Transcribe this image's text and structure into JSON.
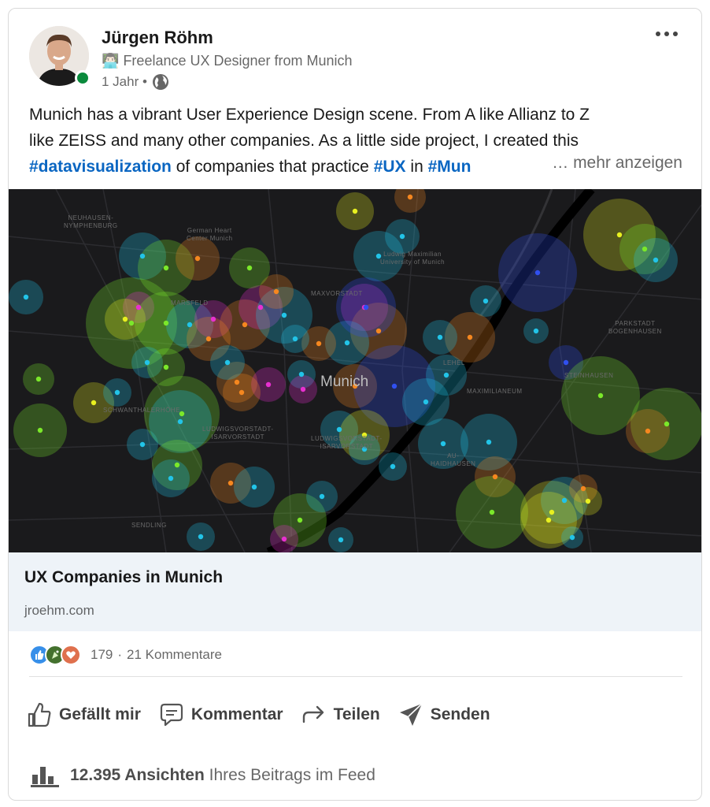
{
  "author": {
    "name": "Jürgen Röhm",
    "headline_emoji": "👨🏻‍💻",
    "headline": "Freelance UX Designer from Munich",
    "time": "1 Jahr •"
  },
  "post": {
    "line1": "Munich has a vibrant User Experience Design scene. From A like Allianz to Z",
    "line2": "like ZEISS and many other companies. As a little side project, I created this",
    "hashtag_dataviz": "#datavisualization",
    "text_mid": " of companies that practice ",
    "hashtag_ux": "#UX",
    "text_in": " in ",
    "hashtag_mun": "#Mun",
    "see_more": "… mehr anzeigen"
  },
  "map": {
    "city_label": "Munich",
    "labels": {
      "neuhausen": "NEUHAUSEN-\nNYMPHENBURG",
      "heart": "German Heart\nCenter Munich",
      "maxvorstadt": "MAXVORSTADT",
      "marsfeld": "MARSFELD",
      "parkstadt": "PARKSTADT\nBOGENHAUSEN",
      "lehel": "LEHEL",
      "steinhausen": "STEINHAUSEN",
      "maximilianeum": "MAXIMILIANEUM",
      "schwanthaler": "SCHWANTHALERHÖHE",
      "ludwigs": "LUDWIGSVORSTADT-\nISARVORSTADT",
      "isarvorstadt": "LUDWIGSVORSTADT-\nISARVORSTADT",
      "au": "AU-\nHAIDHAUSEN",
      "sendling": "SENDLING",
      "lmu": "Ludwig Maximilian\nUniversity of Munich"
    },
    "colors": {
      "background": "#1a1a1c",
      "cyan": "#22c4e8",
      "green": "#7be82a",
      "orange": "#f5871f",
      "magenta": "#e830d0",
      "yellow": "#e8f020",
      "blue": "#3050f0"
    }
  },
  "link": {
    "title": "UX Companies in Munich",
    "domain": "jroehm.com"
  },
  "social": {
    "count": "179",
    "comments": "21 Kommentare"
  },
  "actions": {
    "like": "Gefällt mir",
    "comment": "Kommentar",
    "share": "Teilen",
    "send": "Senden"
  },
  "views": {
    "count": "12.395 Ansichten",
    "suffix": "Ihres Beitrags im Feed"
  },
  "icons": {
    "globe": "globe-icon",
    "like": "thumbs-up-icon",
    "comment": "comment-icon",
    "share": "share-arrow-icon",
    "send": "send-icon",
    "views": "bar-chart-icon",
    "more": "more-dots-icon"
  },
  "theme": {
    "link_blue": "#0a66c2",
    "presence_green": "#0a8a3c"
  }
}
